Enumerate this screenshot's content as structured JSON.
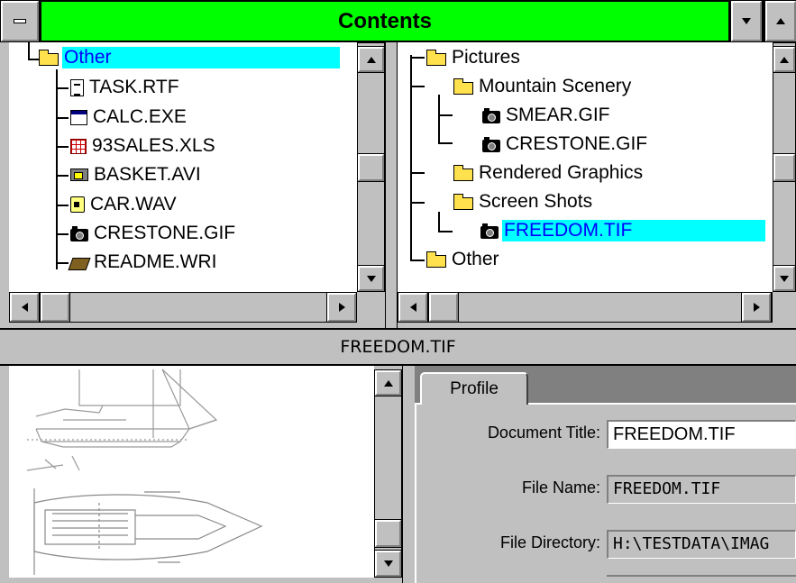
{
  "window": {
    "title": "Contents"
  },
  "left_tree": {
    "root": {
      "label": "Other",
      "icon": "folder-open-icon"
    },
    "items": [
      {
        "label": "TASK.RTF",
        "icon": "document-icon"
      },
      {
        "label": "CALC.EXE",
        "icon": "application-icon"
      },
      {
        "label": "93SALES.XLS",
        "icon": "spreadsheet-icon"
      },
      {
        "label": "BASKET.AVI",
        "icon": "video-icon"
      },
      {
        "label": "CAR.WAV",
        "icon": "sound-icon"
      },
      {
        "label": "CRESTONE.GIF",
        "icon": "camera-icon"
      },
      {
        "label": "README.WRI",
        "icon": "book-icon"
      }
    ]
  },
  "right_tree": {
    "items": [
      {
        "label": "Pictures",
        "icon": "folder-open-icon"
      },
      {
        "label": "Mountain Scenery",
        "icon": "folder-open-icon"
      },
      {
        "label": "SMEAR.GIF",
        "icon": "camera-icon"
      },
      {
        "label": "CRESTONE.GIF",
        "icon": "camera-icon"
      },
      {
        "label": "Rendered Graphics",
        "icon": "folder-icon"
      },
      {
        "label": "Screen Shots",
        "icon": "folder-open-icon"
      },
      {
        "label": "FREEDOM.TIF",
        "icon": "camera-icon",
        "selected": true
      },
      {
        "label": "Other",
        "icon": "folder-icon"
      }
    ]
  },
  "preview": {
    "title": "FREEDOM.TIF"
  },
  "profile": {
    "tab_label": "Profile",
    "fields": [
      {
        "label": "Document Title:",
        "value": "FREEDOM.TIF"
      },
      {
        "label": "File Name:",
        "value": "FREEDOM.TIF"
      },
      {
        "label": "File Directory:",
        "value": "H:\\TESTDATA\\IMAG"
      }
    ]
  },
  "colors": {
    "title_bar": "#00ff00",
    "selection": "#00ffff",
    "selected_text": "#0000ff",
    "face": "#c0c0c0"
  }
}
